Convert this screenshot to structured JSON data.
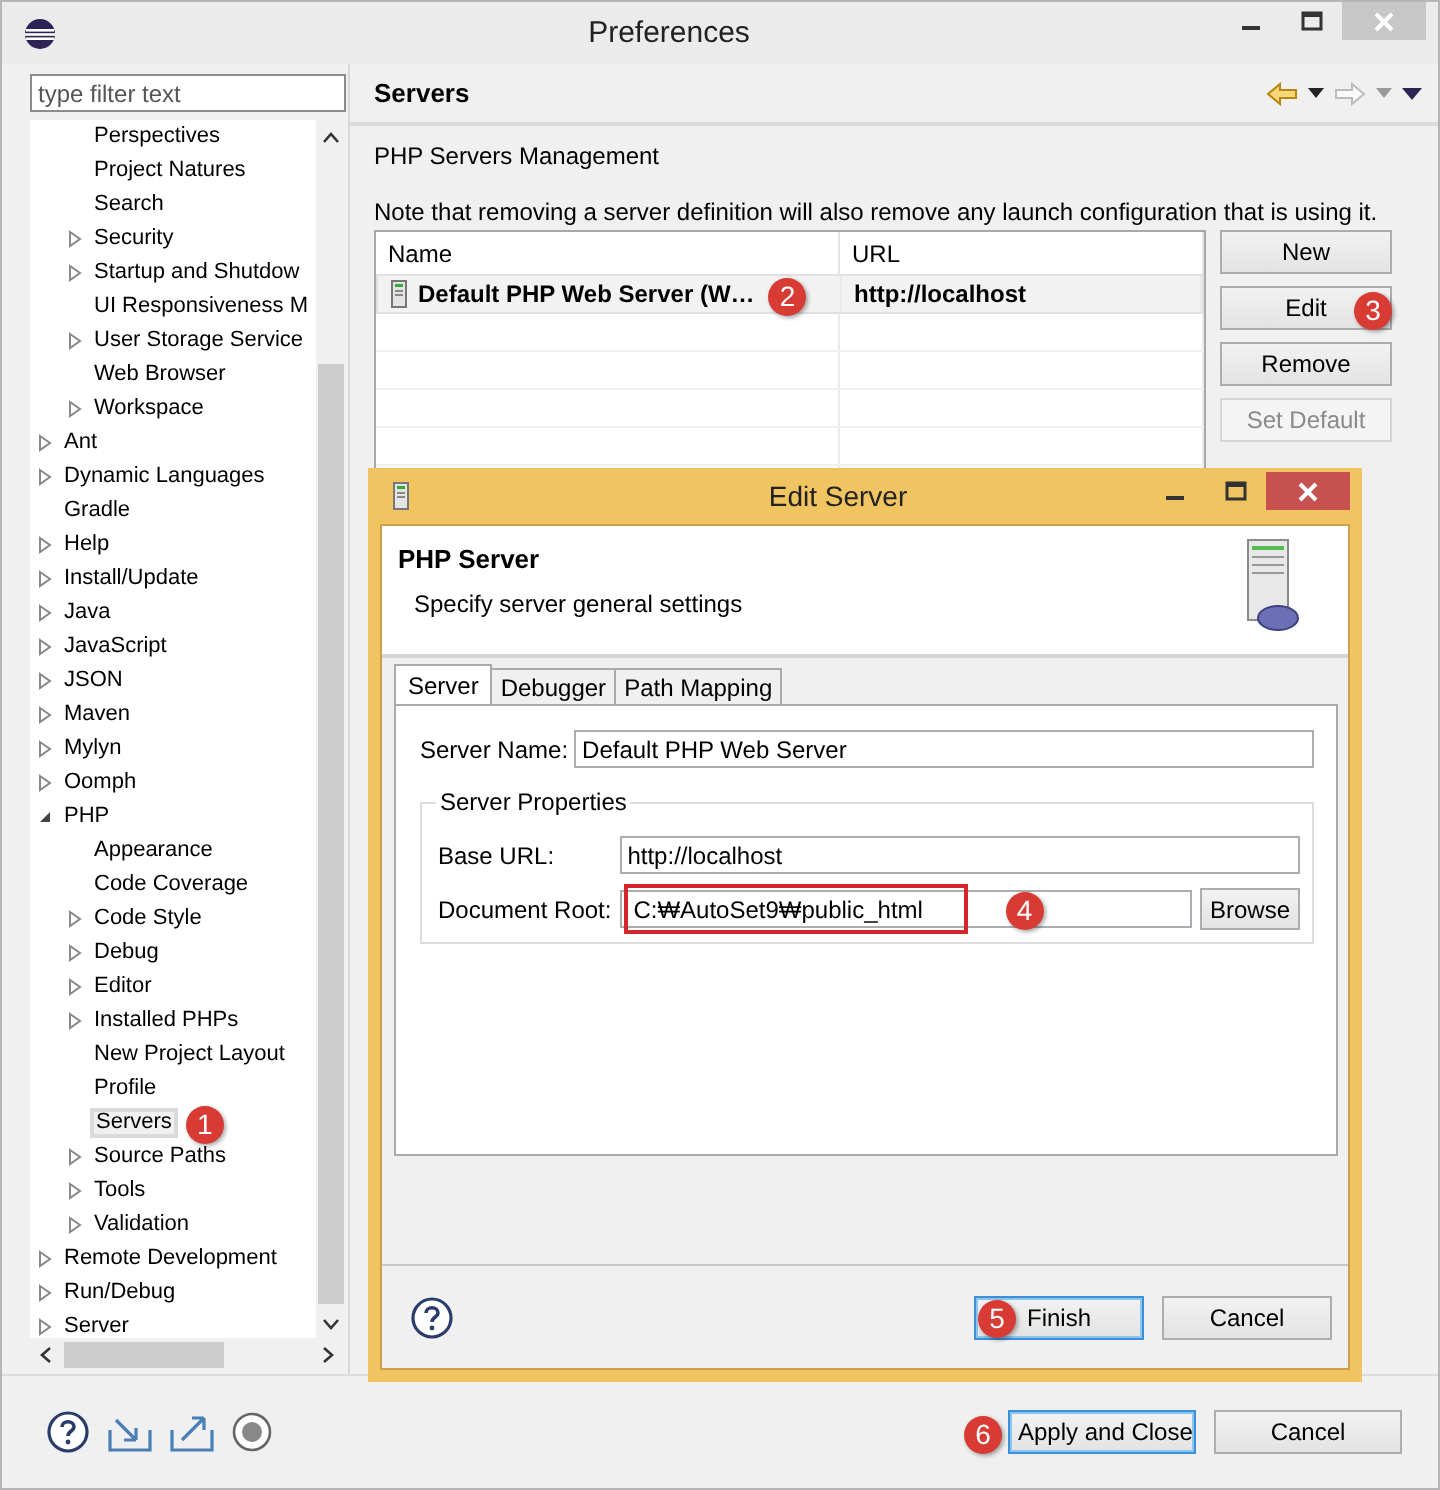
{
  "window": {
    "title": "Preferences"
  },
  "filter": {
    "placeholder": "type filter text"
  },
  "tree": [
    {
      "children": [
        {
          "label": "Perspectives",
          "expandable": false,
          "selected": false
        },
        {
          "label": "Project Natures",
          "expandable": false,
          "selected": false
        },
        {
          "label": "Search",
          "expandable": false,
          "selected": false
        },
        {
          "label": "Security",
          "expandable": true,
          "expanded": false,
          "selected": false
        },
        {
          "label": "Startup and Shutdow",
          "expandable": true,
          "expanded": false,
          "selected": false
        },
        {
          "label": "UI Responsiveness M",
          "expandable": false,
          "selected": false
        },
        {
          "label": "User Storage Service",
          "expandable": true,
          "expanded": false,
          "selected": false
        },
        {
          "label": "Web Browser",
          "expandable": false,
          "selected": false
        },
        {
          "label": "Workspace",
          "expandable": true,
          "expanded": false,
          "selected": false
        }
      ]
    },
    {
      "label": "Ant",
      "expandable": true,
      "expanded": false,
      "selected": false
    },
    {
      "label": "Dynamic Languages",
      "expandable": true,
      "expanded": false,
      "selected": false
    },
    {
      "label": "Gradle",
      "expandable": false,
      "selected": false
    },
    {
      "label": "Help",
      "expandable": true,
      "expanded": false,
      "selected": false
    },
    {
      "label": "Install/Update",
      "expandable": true,
      "expanded": false,
      "selected": false
    },
    {
      "label": "Java",
      "expandable": true,
      "expanded": false,
      "selected": false
    },
    {
      "label": "JavaScript",
      "expandable": true,
      "expanded": false,
      "selected": false
    },
    {
      "label": "JSON",
      "expandable": true,
      "expanded": false,
      "selected": false
    },
    {
      "label": "Maven",
      "expandable": true,
      "expanded": false,
      "selected": false
    },
    {
      "label": "Mylyn",
      "expandable": true,
      "expanded": false,
      "selected": false
    },
    {
      "label": "Oomph",
      "expandable": true,
      "expanded": false,
      "selected": false
    },
    {
      "label": "PHP",
      "expandable": true,
      "expanded": true,
      "selected": false,
      "children": [
        {
          "label": "Appearance",
          "expandable": false,
          "selected": false
        },
        {
          "label": "Code Coverage",
          "expandable": false,
          "selected": false
        },
        {
          "label": "Code Style",
          "expandable": true,
          "expanded": false,
          "selected": false
        },
        {
          "label": "Debug",
          "expandable": true,
          "expanded": false,
          "selected": false
        },
        {
          "label": "Editor",
          "expandable": true,
          "expanded": false,
          "selected": false
        },
        {
          "label": "Installed PHPs",
          "expandable": true,
          "expanded": false,
          "selected": false
        },
        {
          "label": "New Project Layout",
          "expandable": false,
          "selected": false
        },
        {
          "label": "Profile",
          "expandable": false,
          "selected": false
        },
        {
          "label": "Servers",
          "expandable": false,
          "selected": true
        },
        {
          "label": "Source Paths",
          "expandable": true,
          "expanded": false,
          "selected": false
        },
        {
          "label": "Tools",
          "expandable": true,
          "expanded": false,
          "selected": false
        },
        {
          "label": "Validation",
          "expandable": true,
          "expanded": false,
          "selected": false
        }
      ]
    },
    {
      "label": "Remote Development",
      "expandable": true,
      "expanded": false,
      "selected": false
    },
    {
      "label": "Run/Debug",
      "expandable": true,
      "expanded": false,
      "selected": false
    },
    {
      "label": "Server",
      "expandable": true,
      "expanded": false,
      "selected": false
    }
  ],
  "page": {
    "title": "Servers",
    "subtitle": "PHP Servers Management",
    "note": "Note that removing a server definition will also remove any launch configuration that is using it.",
    "table": {
      "columns": [
        "Name",
        "URL"
      ],
      "rows": [
        {
          "name": "Default PHP Web Server (W…",
          "url": "http://localhost",
          "selected": true
        }
      ]
    },
    "buttons": [
      {
        "label": "New",
        "disabled": false
      },
      {
        "label": "Edit",
        "disabled": false
      },
      {
        "label": "Remove",
        "disabled": false
      },
      {
        "label": "Set Default",
        "disabled": true
      }
    ]
  },
  "bottom_buttons": [
    {
      "label": "Apply and Close",
      "default": true
    },
    {
      "label": "Cancel",
      "default": false
    }
  ],
  "dialog": {
    "title": "Edit Server",
    "heading": "PHP Server",
    "description": "Specify server general settings",
    "tabs": [
      {
        "label": "Server",
        "selected": true
      },
      {
        "label": "Debugger",
        "selected": false
      },
      {
        "label": "Path Mapping",
        "selected": false
      }
    ],
    "server_name": {
      "label": "Server Name:",
      "value": "Default PHP Web Server"
    },
    "group": "Server Properties",
    "base_url": {
      "label": "Base URL:",
      "value": "http://localhost"
    },
    "document_root": {
      "label": "Document Root:",
      "value": "C:₩AutoSet9₩public_html"
    },
    "browse": "Browse",
    "buttons": [
      {
        "label": "Finish",
        "default": true
      },
      {
        "label": "Cancel",
        "default": false
      }
    ]
  },
  "annotations": [
    {
      "label": "1",
      "highlight": true
    },
    {
      "label": "2",
      "highlight": false
    },
    {
      "label": "3",
      "highlight": false
    },
    {
      "label": "4",
      "highlight": true
    },
    {
      "label": "5",
      "highlight": false
    },
    {
      "label": "6",
      "highlight": false
    }
  ]
}
